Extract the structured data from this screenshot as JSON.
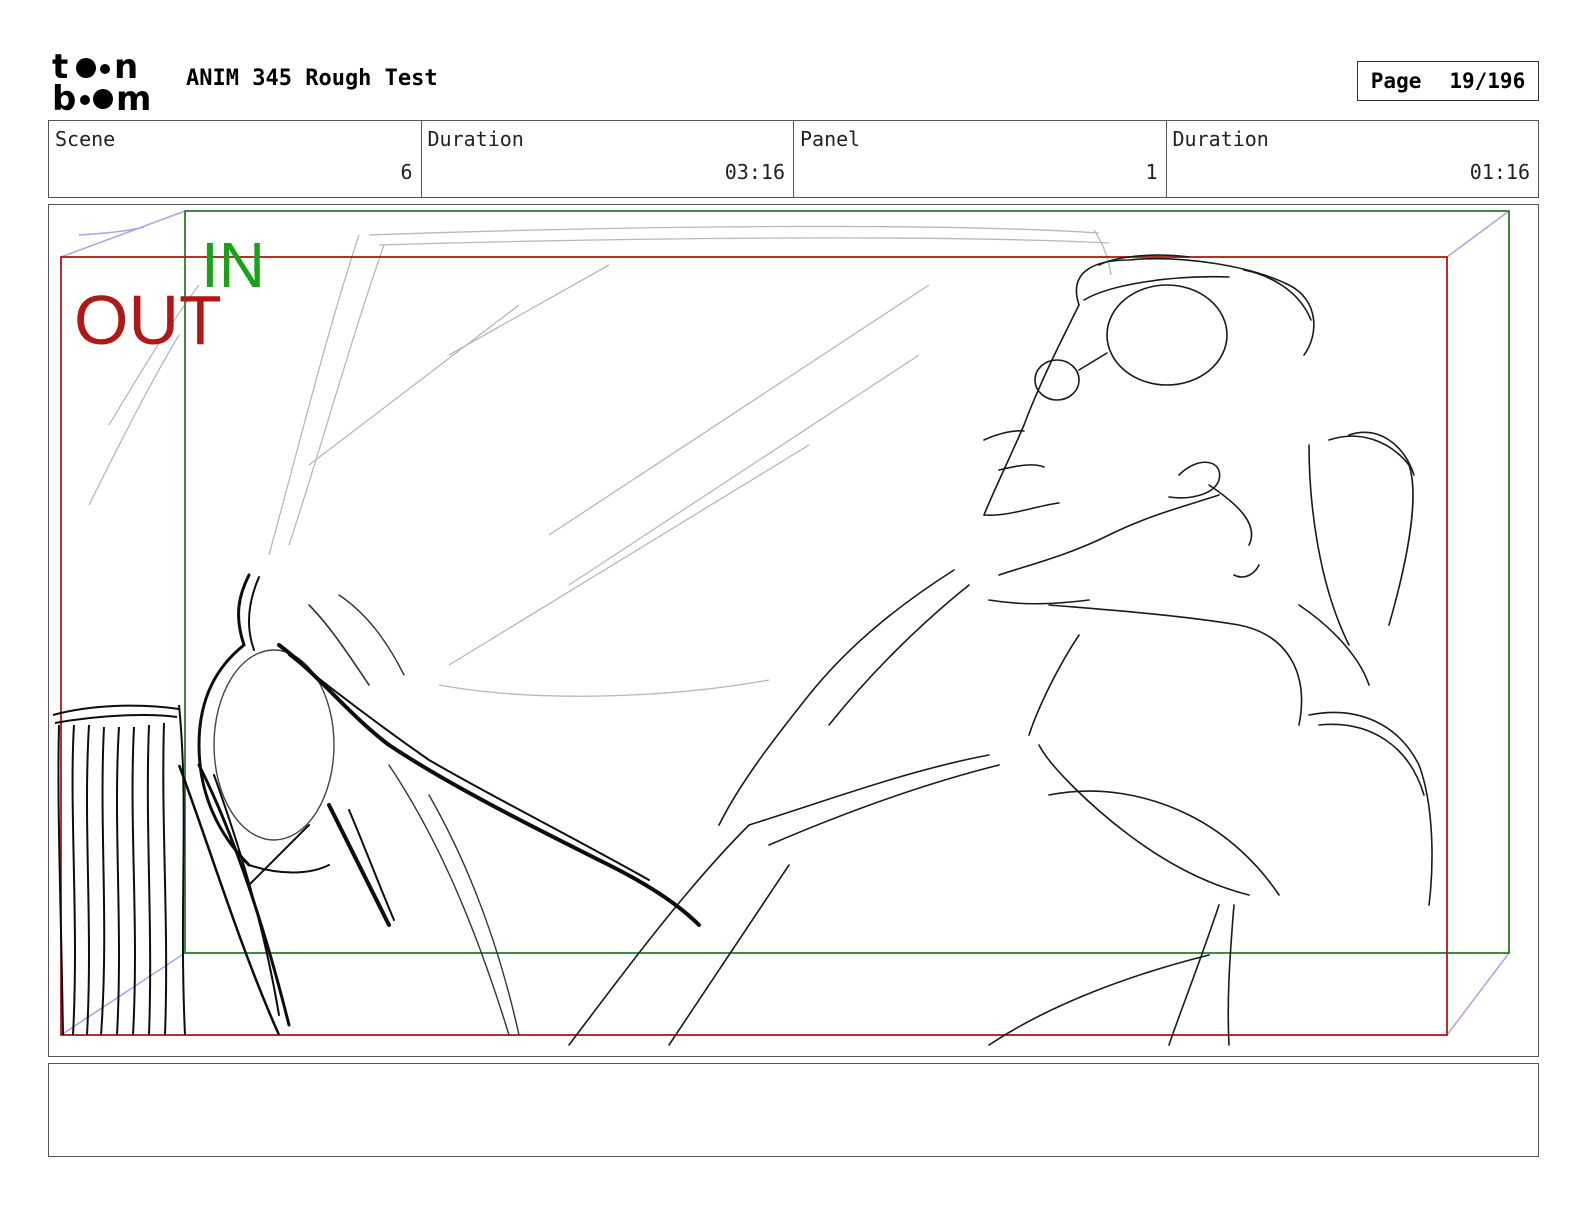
{
  "header": {
    "logo_text": "toon boom",
    "title": "ANIM 345 Rough Test",
    "page_label": "Page",
    "page_value": "19/196"
  },
  "info": {
    "scene_label": "Scene",
    "scene_value": "6",
    "scene_duration_label": "Duration",
    "scene_duration_value": "03:16",
    "panel_label": "Panel",
    "panel_value": "1",
    "panel_duration_label": "Duration",
    "panel_duration_value": "01:16"
  },
  "panel": {
    "in_label": "IN",
    "out_label": "OUT",
    "in_color": "#1aa11a",
    "out_color": "#b01818",
    "in_frame_color": "#2e7d2e",
    "out_frame_color": "#b01818"
  },
  "notes": {
    "text": ""
  }
}
